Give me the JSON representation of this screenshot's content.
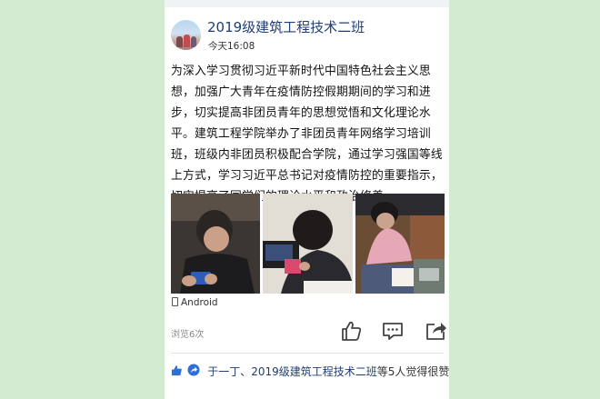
{
  "post": {
    "group_name": "2019级建筑工程技术二班",
    "time": "今天16:08",
    "body": "为深入学习贯彻习近平新时代中国特色社会主义思想，加强广大青年在疫情防控假期期间的学习和进步，切实提高非团员青年的思想觉悟和文化理论水平。建筑工程学院举办了非团员青年网络学习培训班，班级内非团员积极配合学院，通过学习强国等线上方式，学习习近平总书记对疫情防控的重要指示，切实提高了同学们的理论水平和政治修养。",
    "photos": [
      "student-with-phone",
      "student-writing",
      "student-studying-at-table"
    ],
    "platform": "Android",
    "views": "浏览6次"
  },
  "actions": {
    "like_icon": "thumbs-up-icon",
    "comment_icon": "comment-icon",
    "share_icon": "share-icon"
  },
  "likes": {
    "names": "于一丁、2019级建筑工程技术二班",
    "suffix": "等5人觉得很赞"
  },
  "colors": {
    "background": "#d3ecd1",
    "name_blue": "#1f3d78",
    "like_blue": "#2f6fd6"
  }
}
